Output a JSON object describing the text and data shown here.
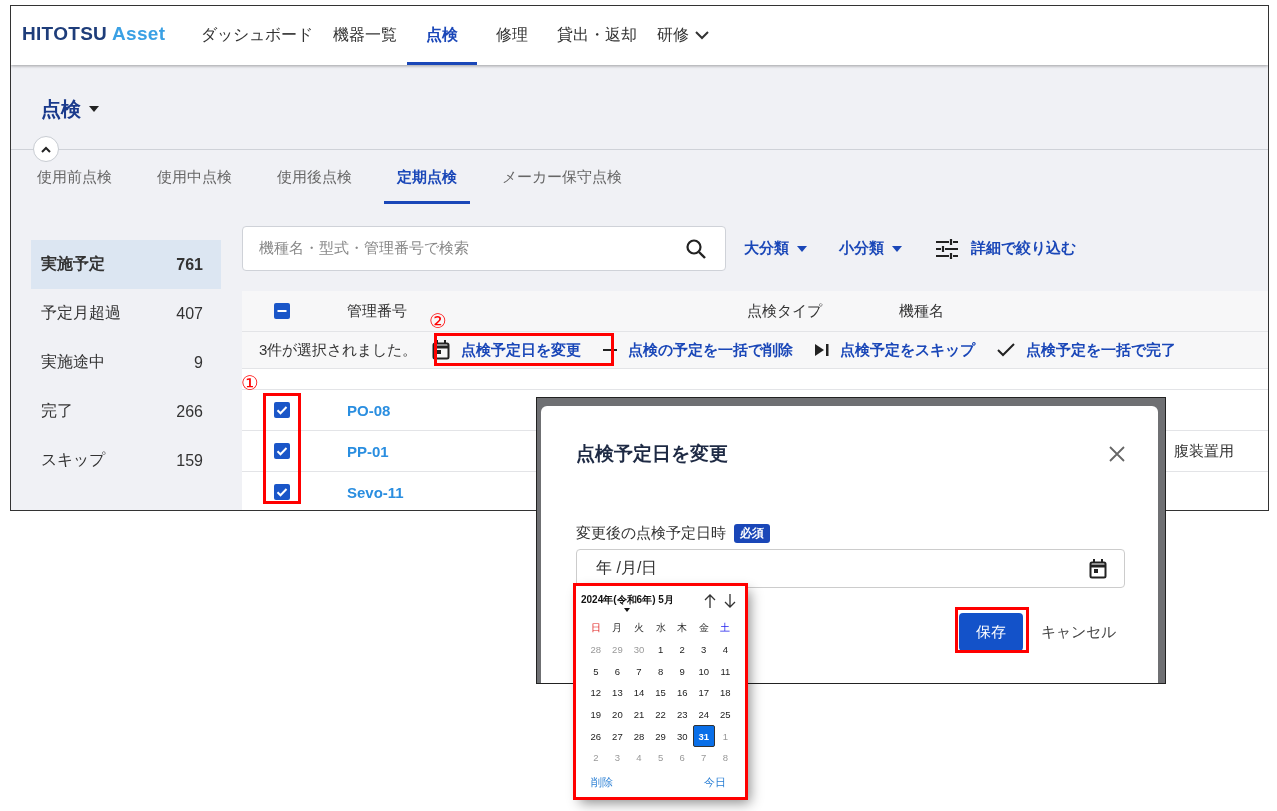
{
  "header": {
    "logo": {
      "text": "HITOTSU",
      "accent": "Asset"
    },
    "nav": [
      {
        "label": "ダッシュボード",
        "selected": false,
        "dropdown": false
      },
      {
        "label": "機器一覧",
        "selected": false,
        "dropdown": false
      },
      {
        "label": "点検",
        "selected": true,
        "dropdown": false
      },
      {
        "label": "修理",
        "selected": false,
        "dropdown": false
      },
      {
        "label": "貸出・返却",
        "selected": false,
        "dropdown": false
      },
      {
        "label": "研修",
        "selected": false,
        "dropdown": true
      }
    ]
  },
  "page_title": "点検",
  "tabs": [
    {
      "label": "使用前点検",
      "selected": false
    },
    {
      "label": "使用中点検",
      "selected": false
    },
    {
      "label": "使用後点検",
      "selected": false
    },
    {
      "label": "定期点検",
      "selected": true
    },
    {
      "label": "メーカー保守点検",
      "selected": false
    }
  ],
  "sidebar": {
    "items": [
      {
        "label": "実施予定",
        "count": "761",
        "selected": true
      },
      {
        "label": "予定月超過",
        "count": "407",
        "selected": false
      },
      {
        "label": "実施途中",
        "count": "9",
        "selected": false
      },
      {
        "label": "完了",
        "count": "266",
        "selected": false
      },
      {
        "label": "スキップ",
        "count": "159",
        "selected": false
      }
    ]
  },
  "search": {
    "placeholder": "機種名・型式・管理番号で検索"
  },
  "filters": [
    {
      "label": "大分類",
      "kind": "dropdown"
    },
    {
      "label": "小分類",
      "kind": "dropdown"
    },
    {
      "label": "詳細で絞り込む",
      "kind": "filter"
    }
  ],
  "table": {
    "header_checkbox": {
      "indeterminate": true
    },
    "columns": [
      "管理番号",
      "点検タイプ",
      "機種名"
    ],
    "selection": {
      "text": "3件が選択されました。",
      "actions": [
        {
          "label": "点検予定日を変更",
          "kind": "calendar"
        },
        {
          "label": "点検の予定を一括で削除",
          "kind": "minus"
        },
        {
          "label": "点検予定をスキップ",
          "kind": "skip"
        },
        {
          "label": "点検予定を一括で完了",
          "kind": "check"
        }
      ]
    },
    "rows": [
      {
        "id": "PO-08",
        "checked": true
      },
      {
        "id": "PP-01",
        "checked": true,
        "column_3": "腹装置用"
      },
      {
        "id": "Sevo-11",
        "checked": true
      }
    ]
  },
  "dialog": {
    "title": "点検予定日を変更",
    "field_label": "変更後の点検予定日時",
    "required_badge": "必須",
    "date_value": "年 /月/日",
    "buttons": [
      {
        "label": "保存",
        "kind": "primary"
      },
      {
        "label": "キャンセル",
        "kind": "text"
      }
    ]
  },
  "date_picker": {
    "month": "2024年(令和6年) 5月",
    "weekdays": [
      {
        "label": "日",
        "kind": "sunday"
      },
      {
        "label": "月",
        "kind": "weekday"
      },
      {
        "label": "火",
        "kind": "weekday"
      },
      {
        "label": "水",
        "kind": "weekday"
      },
      {
        "label": "木",
        "kind": "weekday"
      },
      {
        "label": "金",
        "kind": "weekday"
      },
      {
        "label": "土",
        "kind": "saturday"
      }
    ],
    "weeks": [
      [
        {
          "day": "28",
          "outside": true,
          "selected": false
        },
        {
          "day": "29",
          "outside": true,
          "selected": false
        },
        {
          "day": "30",
          "outside": true,
          "selected": false
        },
        {
          "day": "1",
          "outside": false,
          "selected": false
        },
        {
          "day": "2",
          "outside": false,
          "selected": false
        },
        {
          "day": "3",
          "outside": false,
          "selected": false
        },
        {
          "day": "4",
          "outside": false,
          "selected": false
        }
      ],
      [
        {
          "day": "5",
          "outside": false,
          "selected": false
        },
        {
          "day": "6",
          "outside": false,
          "selected": false
        },
        {
          "day": "7",
          "outside": false,
          "selected": false
        },
        {
          "day": "8",
          "outside": false,
          "selected": false
        },
        {
          "day": "9",
          "outside": false,
          "selected": false
        },
        {
          "day": "10",
          "outside": false,
          "selected": false
        },
        {
          "day": "11",
          "outside": false,
          "selected": false
        }
      ],
      [
        {
          "day": "12",
          "outside": false,
          "selected": false
        },
        {
          "day": "13",
          "outside": false,
          "selected": false
        },
        {
          "day": "14",
          "outside": false,
          "selected": false
        },
        {
          "day": "15",
          "outside": false,
          "selected": false
        },
        {
          "day": "16",
          "outside": false,
          "selected": false
        },
        {
          "day": "17",
          "outside": false,
          "selected": false
        },
        {
          "day": "18",
          "outside": false,
          "selected": false
        }
      ],
      [
        {
          "day": "19",
          "outside": false,
          "selected": false
        },
        {
          "day": "20",
          "outside": false,
          "selected": false
        },
        {
          "day": "21",
          "outside": false,
          "selected": false
        },
        {
          "day": "22",
          "outside": false,
          "selected": false
        },
        {
          "day": "23",
          "outside": false,
          "selected": false
        },
        {
          "day": "24",
          "outside": false,
          "selected": false
        },
        {
          "day": "25",
          "outside": false,
          "selected": false
        }
      ],
      [
        {
          "day": "26",
          "outside": false,
          "selected": false
        },
        {
          "day": "27",
          "outside": false,
          "selected": false
        },
        {
          "day": "28",
          "outside": false,
          "selected": false
        },
        {
          "day": "29",
          "outside": false,
          "selected": false
        },
        {
          "day": "30",
          "outside": false,
          "selected": false
        },
        {
          "day": "31",
          "outside": false,
          "selected": true
        },
        {
          "day": "1",
          "outside": true,
          "selected": false
        }
      ],
      [
        {
          "day": "2",
          "outside": true,
          "selected": false
        },
        {
          "day": "3",
          "outside": true,
          "selected": false
        },
        {
          "day": "4",
          "outside": true,
          "selected": false
        },
        {
          "day": "5",
          "outside": true,
          "selected": false
        },
        {
          "day": "6",
          "outside": true,
          "selected": false
        },
        {
          "day": "7",
          "outside": true,
          "selected": false
        },
        {
          "day": "8",
          "outside": true,
          "selected": false
        }
      ]
    ],
    "clear": "削除",
    "today": "今日"
  },
  "annotations": [
    {
      "label": "①"
    },
    {
      "label": "②"
    }
  ]
}
